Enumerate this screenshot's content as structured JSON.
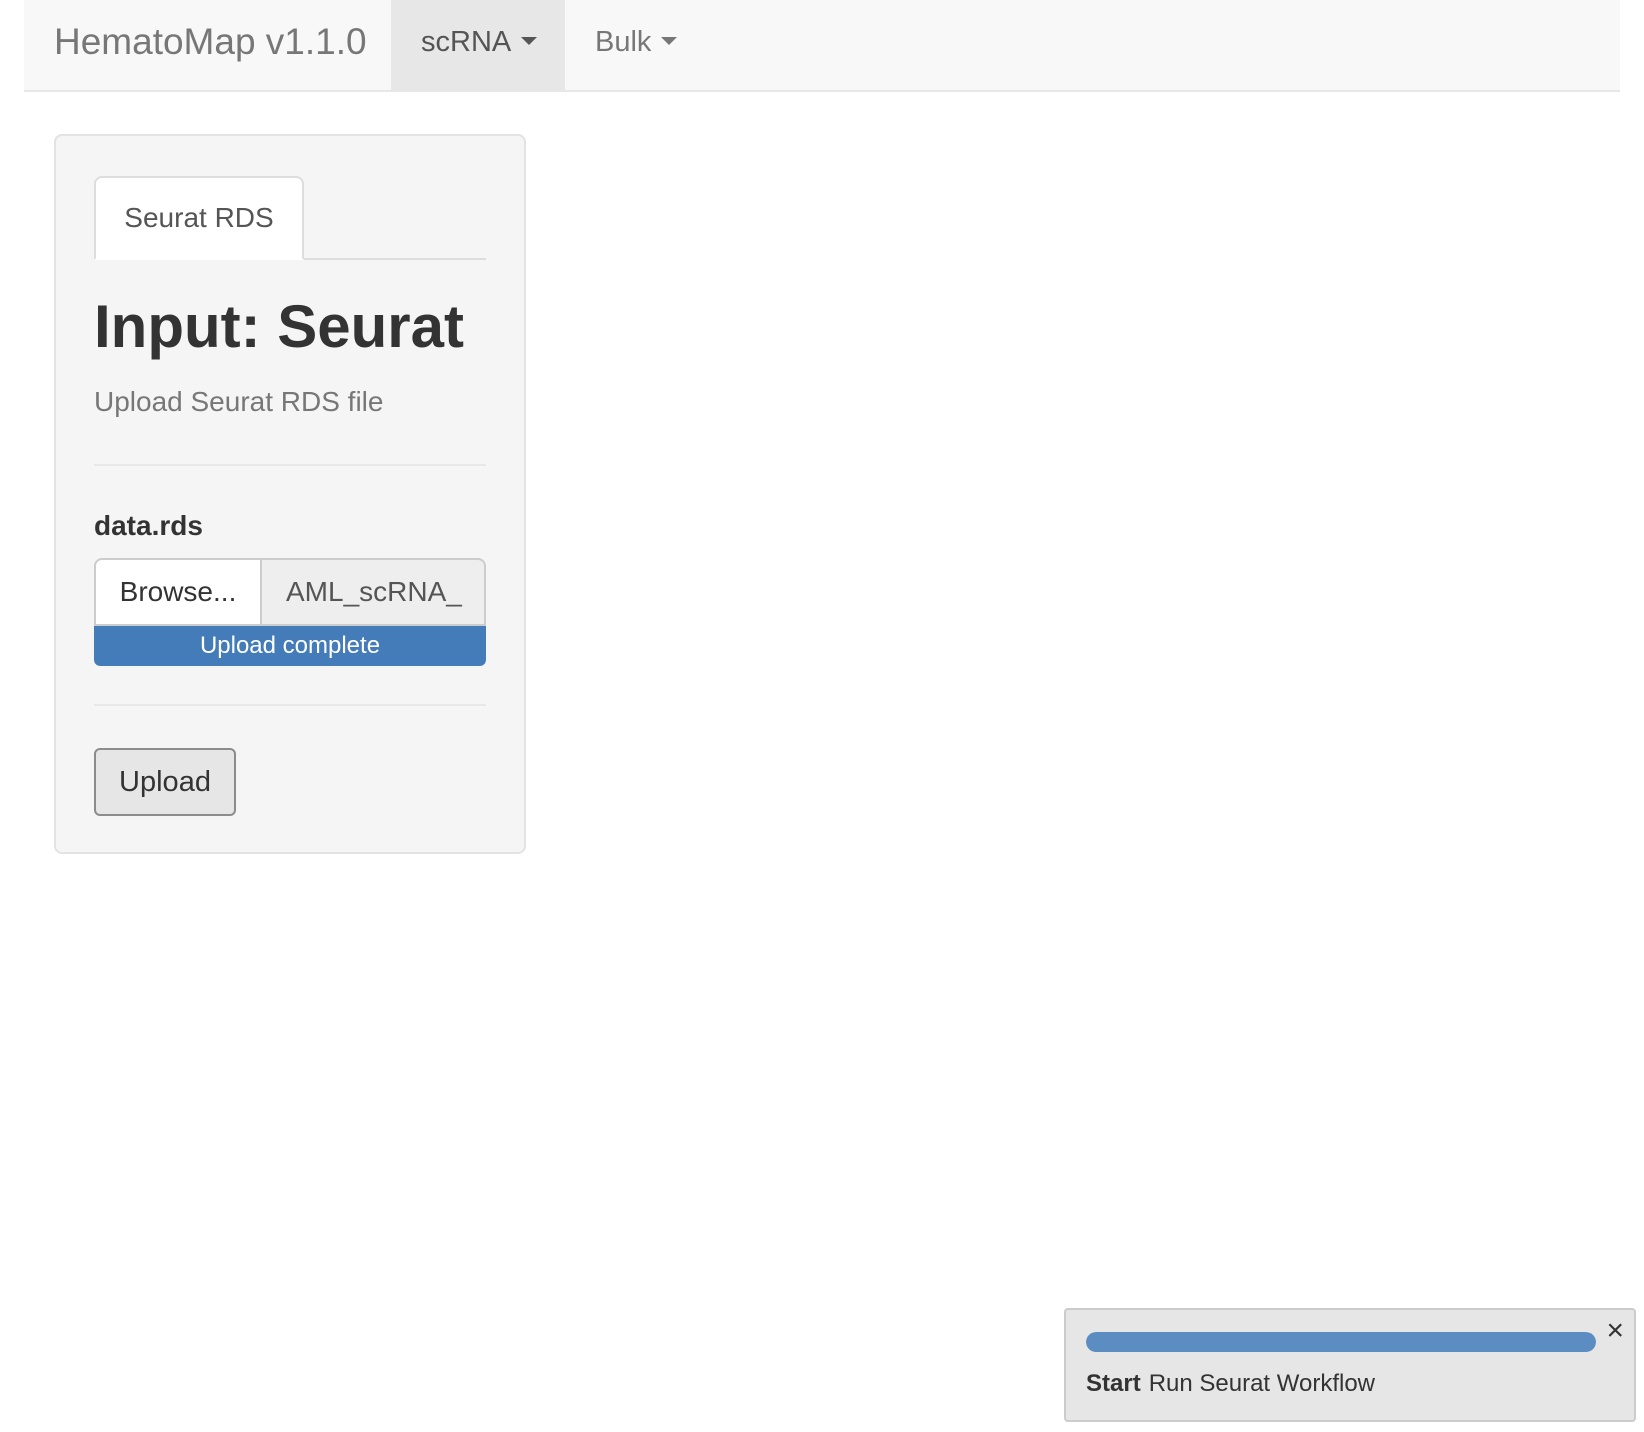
{
  "navbar": {
    "brand": "HematoMap v1.1.0",
    "menus": [
      {
        "label": "scRNA",
        "active": true
      },
      {
        "label": "Bulk",
        "active": false
      }
    ]
  },
  "panel": {
    "tab": "Seurat RDS",
    "title": "Input: Seurat",
    "subtitle": "Upload Seurat RDS file",
    "file_input": {
      "label": "data.rds",
      "browse_label": "Browse...",
      "file_name": "AML_scRNA_",
      "progress_text": "Upload complete",
      "progress": 1.0
    },
    "upload_button": "Upload"
  },
  "notification": {
    "progress": 1.0,
    "strong": "Start",
    "message": "Run Seurat Workflow",
    "close_icon": "close-icon"
  },
  "colors": {
    "progress_bar": "#437cb8",
    "notification_progress": "#5b8cc2",
    "navbar_bg": "#f8f8f8",
    "active_nav_bg": "#e7e7e7"
  }
}
